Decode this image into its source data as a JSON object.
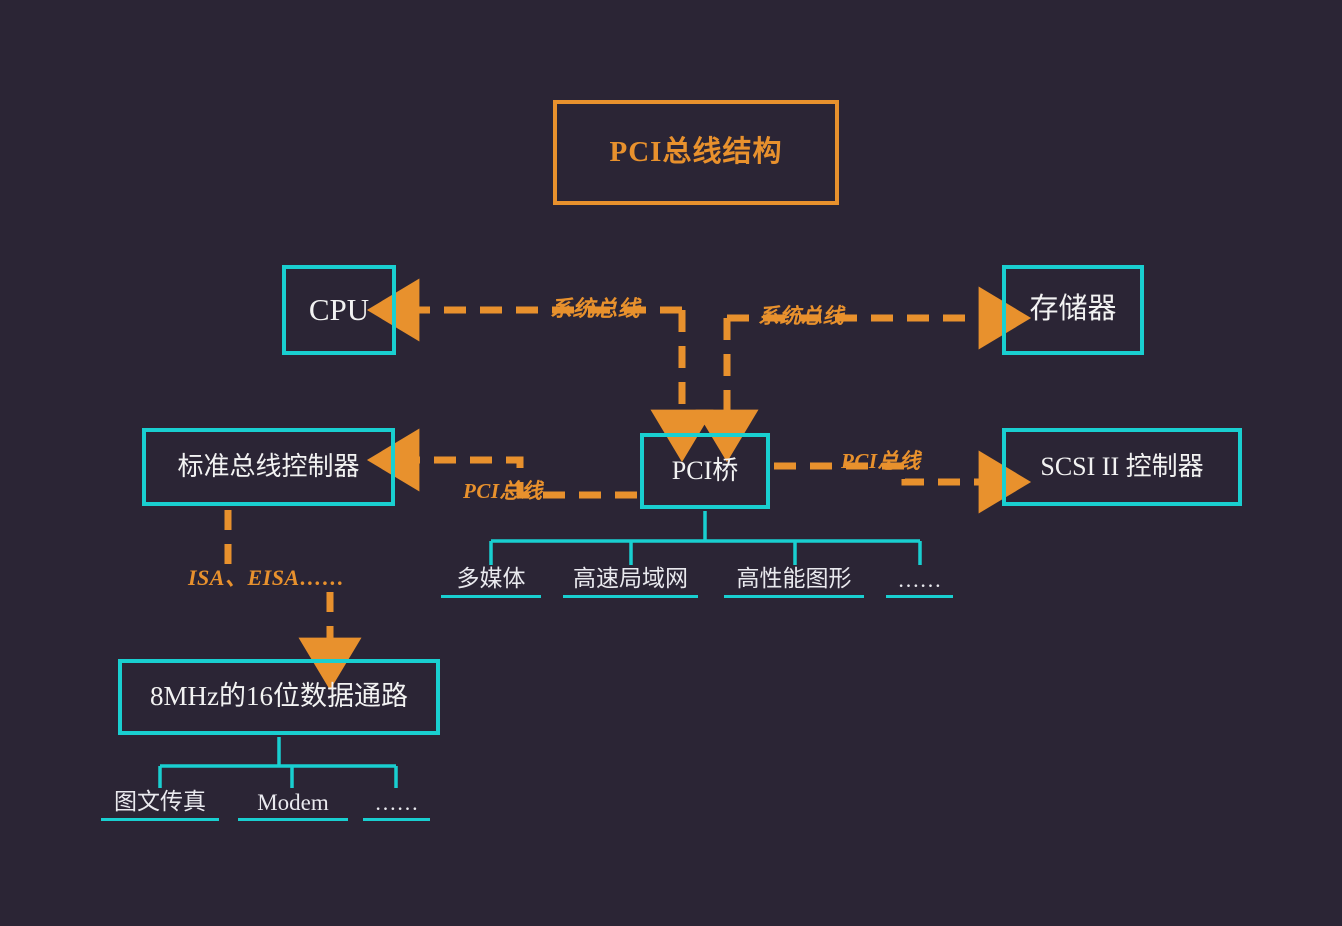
{
  "palette": {
    "background": "#2b2535",
    "accent_orange": "#e8912d",
    "accent_cyan": "#19cfd0",
    "text_light": "#f2f2f2"
  },
  "diagram": {
    "title": "PCI总线结构",
    "boxes": {
      "cpu": "CPU",
      "memory": "存储器",
      "standard_bus_controller": "标准总线控制器",
      "pci_bridge": "PCI桥",
      "scsi_controller": "SCSI II 控制器",
      "data_path": "8MHz的16位数据通路"
    },
    "bus_labels": {
      "system_bus_left": "系统总线",
      "system_bus_right": "系统总线",
      "pci_bus_left": "PCI总线",
      "pci_bus_right": "PCI总线",
      "isa_eisa": "ISA、EISA……"
    },
    "pci_devices": [
      "多媒体",
      "高速局域网",
      "高性能图形",
      "……"
    ],
    "isa_devices": [
      "图文传真",
      "Modem",
      "……"
    ]
  }
}
